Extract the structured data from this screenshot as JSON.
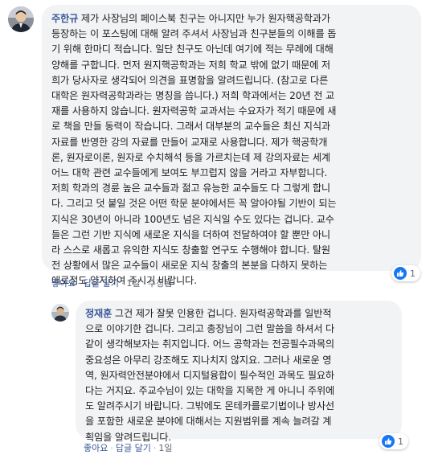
{
  "comment1": {
    "author": "주한규",
    "body": "제가 사장님의 페이스북 친구는 아니지만 누가 원자핵공학과가\n등장하는 이 포스팅에 대해 알려 주셔서 사장님과 친구분들의 이해를 돕\n기 위해 한마디 적습니다. 일단 친구도 아닌데 여기에 적는 무례에 대해\n양해를 구합니다. 먼저 원지핵공학과는 저희 학교 밖에 없기 때문에 저\n희가 당사자로 생각되어 의견을 표명함을 알려드립니다. (참고로 다른\n대학은 원자력공학과라는 명칭을 씁니다.) 저희 학과에서는 20년 전 교\n재를 사용하지 않습니다. 원자력공학 교과서는 수요자가 적기 때문에 새\n로 책을 만들 동력이 작습니다. 그래서 대부분의 교수들은 최신 지식과\n자료를 반영한 강의 자료를 만들어 교재로 사용합니다. 제가 핵공학개\n론, 원자로이론, 원자로 수치해석 등을 가르치는데 제 강의자료는 세계\n어느 대학 관련 교수들에게 보여도 부끄럽지 않을 거라고 자부합니다.\n저희 학과의 경륜 높은 교수들과 젊고 유능한 교수들도 다 그렇게 합니\n다. 그리고 덧 붙일 것은 어떤 학문 분야에서든 꼭 알아야될 기반이 되는\n지식은 30년이 아니라 100년도 넘은 지식일 수도 있다는 겁니다. 교수\n들은 그런 기반 지식에 새로운 지식을 더하여 전달하여야 할 뿐만 아니\n라 스스로 새롭고 유익한 지식도 창출할 연구도 수행해야 합니다. 탈원\n전 상황에서 많은 교수들이 새로운 지식 창출의 본분을 다하지 못하는\n애로점도 양지하여 주시기 바랍니다.",
    "actions": {
      "like": "좋아요",
      "reply": "답글 달기",
      "time": "1일",
      "edited": "수정됨"
    },
    "reaction_count": "1"
  },
  "comment2": {
    "author": "정재훈",
    "body": "그건 제가 잘못 인용한 겁니다. 원자력공학과를 일반적\n으로 이야기한 겁니다. 그리고 총장님이 그런 말씀을 하셔서 다\n같이 생각해보자는 취지입니다. 어느 공학과는 전공필수과목의\n중요성은 아무리 강조해도 지나치지 않지요. 그러나 새로운 영\n역, 원자력안전분야에서 디지털융합이 필수적인 과목도 필요하\n다는 거지요. 주교수님이 있는 대학을 지목한 게 아니니 주위에\n도 알려주시기 바랍니다. 그밖에도 몬테카를로기법이나 방사선\n을 포함한 새로운 분야에 대해서는 지원범위를 계속 늘려갈 계\n획임을 알려드립니다.",
    "actions": {
      "like": "좋아요",
      "reply": "답글 달기",
      "time": "1일"
    },
    "reaction_count": "1"
  },
  "colors": {
    "link": "#385898",
    "bubble": "#f2f3f5",
    "like": "#1877f2"
  }
}
